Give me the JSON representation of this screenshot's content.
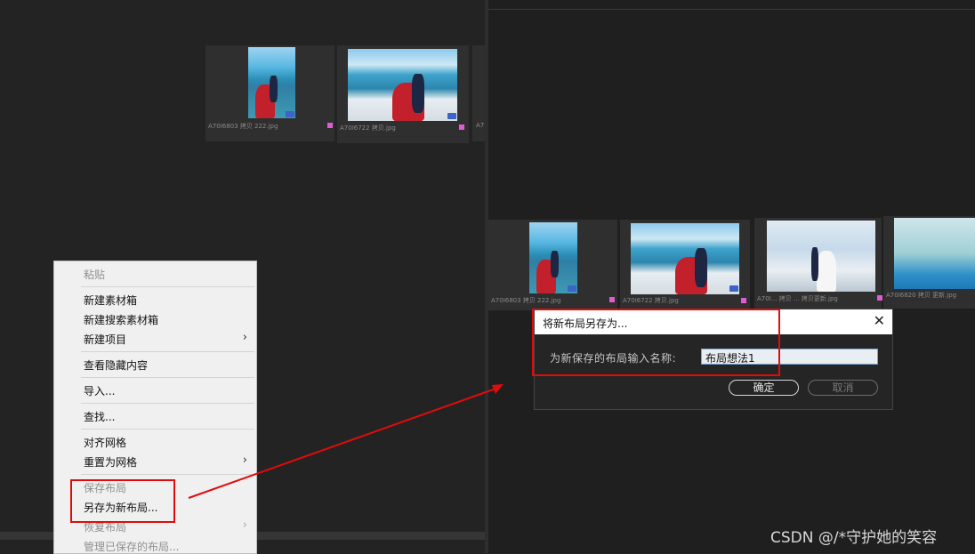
{
  "left_pane": {
    "thumbnails": [
      {
        "caption": "A70I6803  拷贝 222.jpg"
      },
      {
        "caption": "A70I6722  拷贝.jpg"
      },
      {
        "caption": "A7"
      }
    ]
  },
  "right_pane": {
    "thumbnails": [
      {
        "caption": "A70I6803  拷贝 222.jpg"
      },
      {
        "caption": "A70I6722  拷贝.jpg"
      },
      {
        "caption": "A70I... 拷贝 ... 拷贝更新.jpg"
      },
      {
        "caption": "A70I6820  拷贝 更新.jpg"
      }
    ]
  },
  "context_menu": {
    "paste": "粘贴",
    "new_bin": "新建素材箱",
    "new_search_bin": "新建搜索素材箱",
    "new_item": "新建项目",
    "view_hidden": "查看隐藏内容",
    "import": "导入...",
    "find": "查找...",
    "align_grid": "对齐网格",
    "reset_grid": "重置为网格",
    "save_layout": "保存布局",
    "save_as_new_layout": "另存为新布局...",
    "restore_layout": "恢复布局",
    "manage_layouts": "管理已保存的布局..."
  },
  "dialog": {
    "title": "将新布局另存为...",
    "prompt": "为新保存的布局输入名称:",
    "name_value": "布局想法1",
    "ok_label": "确定",
    "cancel_label": "取消"
  },
  "annotation_color": "#e10b0b",
  "watermark": "CSDN @/*守护她的笑容"
}
